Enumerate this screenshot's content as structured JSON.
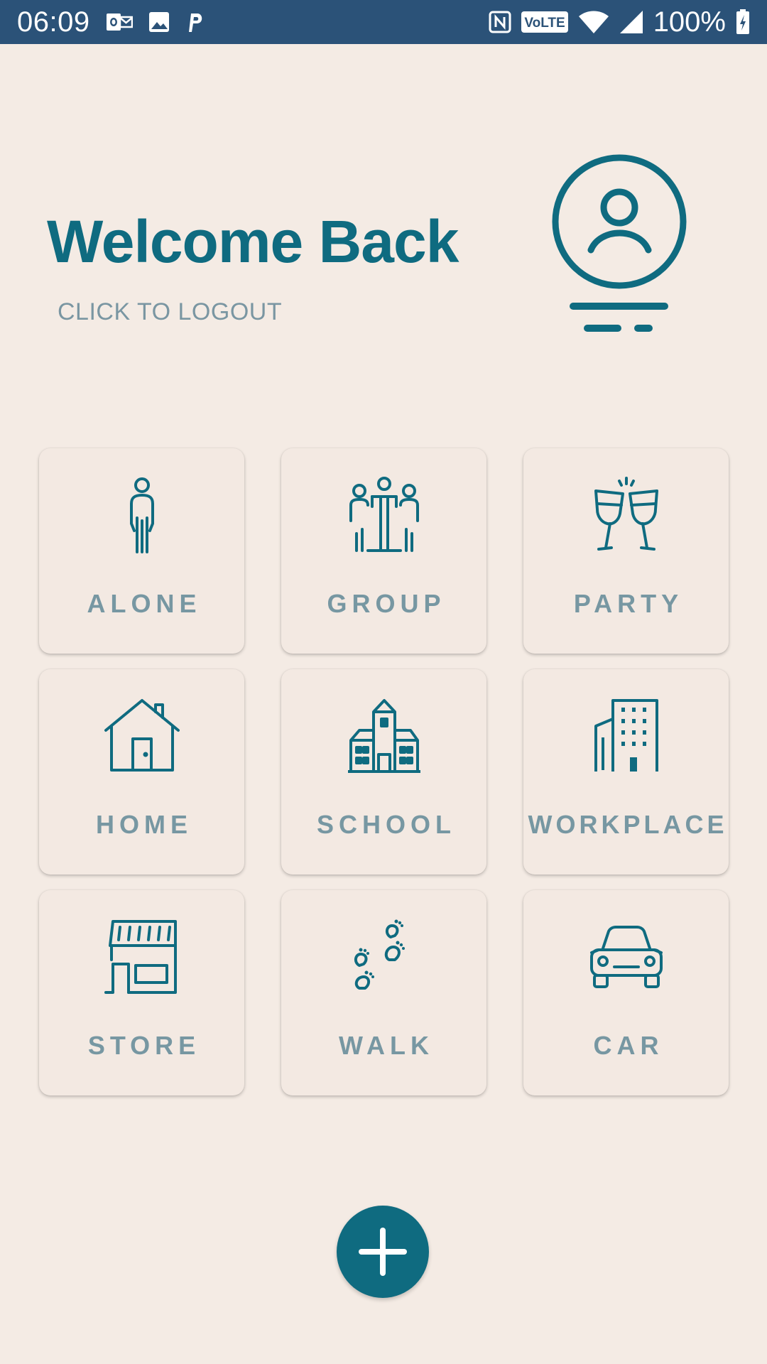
{
  "status_bar": {
    "time": "06:09",
    "battery_percent": "100%",
    "left_icons": [
      "outlook-icon",
      "image-icon",
      "parking-icon"
    ],
    "right_icons": [
      "nfc-icon",
      "volte-icon",
      "wifi-icon",
      "signal-icon",
      "battery-charging-icon"
    ],
    "background": "#2b5278"
  },
  "header": {
    "title": "Welcome Back",
    "logout_label": "CLICK TO LOGOUT",
    "avatar_icon": "user-profile-icon"
  },
  "tiles": [
    {
      "label": "ALONE",
      "icon": "person-icon"
    },
    {
      "label": "GROUP",
      "icon": "group-icon"
    },
    {
      "label": "PARTY",
      "icon": "champagne-toast-icon"
    },
    {
      "label": "HOME",
      "icon": "house-icon"
    },
    {
      "label": "SCHOOL",
      "icon": "school-building-icon"
    },
    {
      "label": "WORKPLACE",
      "icon": "office-building-icon"
    },
    {
      "label": "STORE",
      "icon": "storefront-icon"
    },
    {
      "label": "WALK",
      "icon": "footprints-icon"
    },
    {
      "label": "CAR",
      "icon": "car-icon"
    }
  ],
  "fab": {
    "icon": "plus-icon"
  },
  "colors": {
    "background": "#f4ebe4",
    "accent": "#0f6b80",
    "label": "#7797a2"
  }
}
